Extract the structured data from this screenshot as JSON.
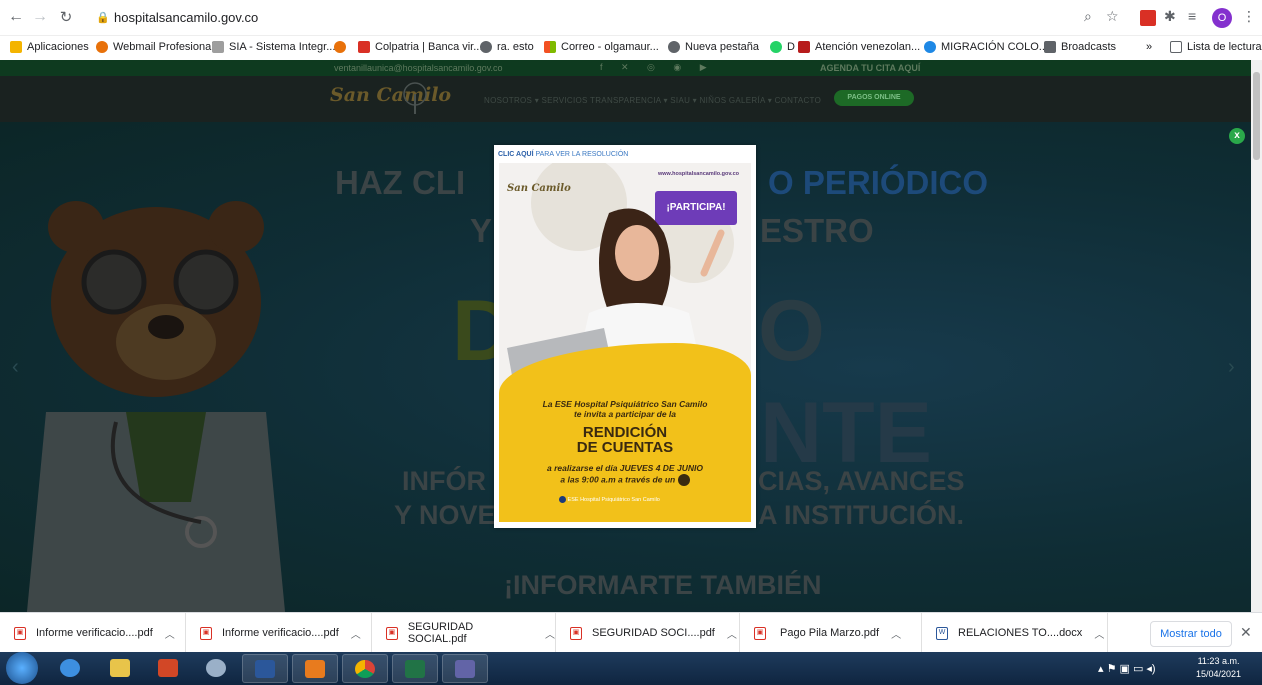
{
  "browser": {
    "url": "hospitalsancamilo.gov.co",
    "bookmarks": [
      {
        "label": "Aplicaciones",
        "color": "#f4b400"
      },
      {
        "label": "Webmail Profesional",
        "color": "#e8710a"
      },
      {
        "label": "SIA - Sistema Integr...",
        "color": "#9e9e9e"
      },
      {
        "label": "",
        "color": "#e8710a"
      },
      {
        "label": "Colpatria | Banca vir...",
        "color": "#d93025"
      },
      {
        "label": "ra. esto",
        "color": "#5f6368"
      },
      {
        "label": "Correo - olgamaur...",
        "color": "#f25022"
      },
      {
        "label": "Nueva pestaña",
        "color": "#5f6368"
      },
      {
        "label": "D",
        "color": "#25d366"
      },
      {
        "label": "Atención venezolan...",
        "color": "#b71c1c"
      },
      {
        "label": "MIGRACIÓN COLO...",
        "color": "#1e88e5"
      },
      {
        "label": "Broadcasts",
        "color": "#5f6368"
      }
    ],
    "bookmarks_more": "»",
    "reading_list": "Lista de lectura",
    "profile_initial": "O"
  },
  "site": {
    "top_email": "ventanillaunica@hospitalsancamilo.gov.co",
    "top_agenda": "AGENDA TU CITA AQUÍ",
    "logo": "San Camilo",
    "nav": "NOSOTROS ▾  SERVICIOS  TRANSPARENCIA ▾  SIAU ▾  NIÑOS  GALERÍA ▾  CONTACTO",
    "pago_online": "PAGOS ONLINE",
    "hero": {
      "line1a": "HAZ CLI",
      "line1b": "O PERIÓDICO",
      "line2a": "Y",
      "line2b": "ESTRO",
      "big1": "D",
      "big2": "O",
      "big3": "NTE",
      "line3a": "INFÓR",
      "line3b": "CIAS, AVANCES",
      "line4a": "Y NOVE",
      "line4b": "A INSTITUCIÓN.",
      "line5": "¡INFORMARTE TAMBIÉN"
    },
    "close_icon": "x"
  },
  "modal": {
    "header_bold": "CLIC AQUÍ",
    "header_rest": " PARA VER LA RESOLUCIÓN",
    "poster": {
      "url": "www.hospitalsancamilo.gov.co",
      "logo": "San Camilo",
      "badge": "¡PARTICIPA!",
      "invite1": "La ESE Hospital Psiquiátrico San Camilo",
      "invite2": "te invita a participar de la",
      "title1": "RENDICIÓN",
      "title2": "DE CUENTAS",
      "detail1": "a realizarse el día JUEVES 4 DE JUNIO",
      "detail2": "a las 9:00 a.m a través de un",
      "fb_page": "ESE Hospital Psiquiátrico San Camilo"
    }
  },
  "downloads": {
    "items": [
      {
        "name": "Informe verificacio....pdf",
        "type": "pdf"
      },
      {
        "name": "Informe verificacio....pdf",
        "type": "pdf"
      },
      {
        "name": "SEGURIDAD SOCIAL.pdf",
        "type": "pdf"
      },
      {
        "name": "SEGURIDAD SOCI....pdf",
        "type": "pdf"
      },
      {
        "name": "Pago Pila Marzo.pdf",
        "type": "pdf"
      },
      {
        "name": "RELACIONES TO....docx",
        "type": "docx"
      }
    ],
    "show_all": "Mostrar todo"
  },
  "taskbar": {
    "time": "11:23 a.m.",
    "date": "15/04/2021"
  }
}
